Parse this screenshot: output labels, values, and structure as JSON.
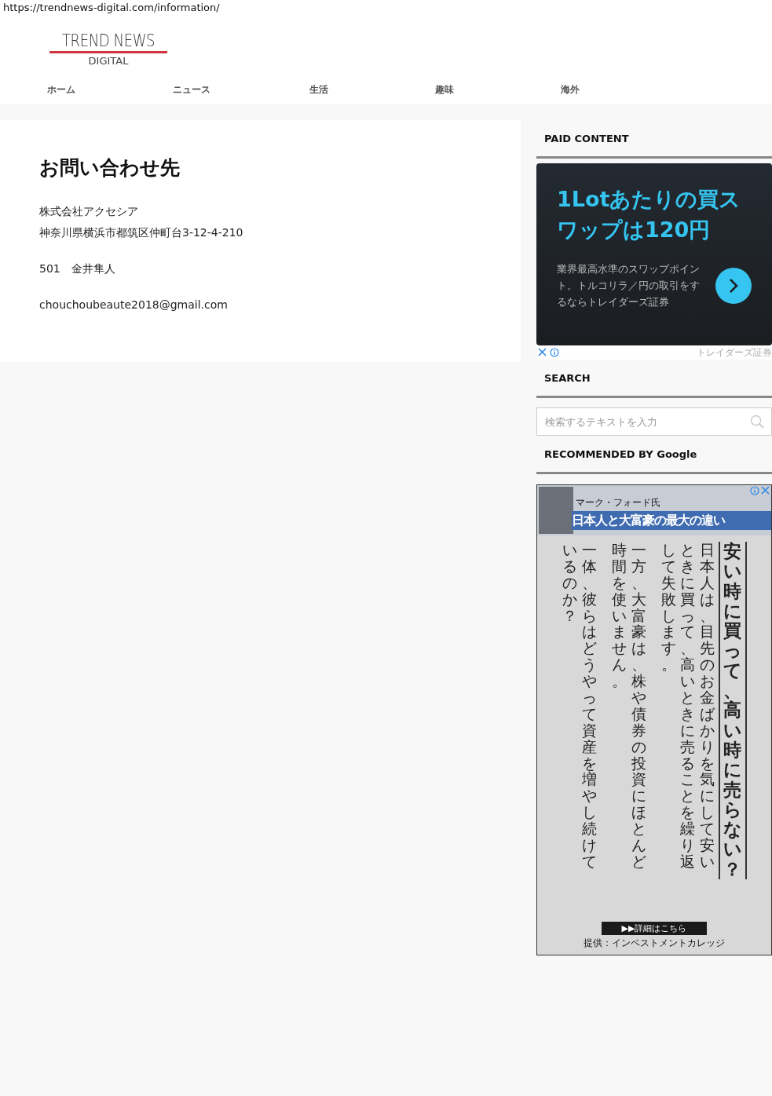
{
  "print_header": {
    "url": "https://trendnews-digital.com/information/"
  },
  "logo": {
    "title": "TREND NEWS",
    "subtitle": "DIGITAL"
  },
  "nav": [
    {
      "label": "ホーム"
    },
    {
      "label": "ニュース"
    },
    {
      "label": "生活"
    },
    {
      "label": "趣味"
    },
    {
      "label": "海外"
    }
  ],
  "article": {
    "title": "お問い合わせ先",
    "paragraphs": [
      [
        "株式会社アクセシア",
        "神奈川県横浜市都筑区仲町台3-12-4-210"
      ],
      [
        "501　金井隼人"
      ],
      [
        "chouchoubeaute2018@gmail.com"
      ]
    ]
  },
  "sidebar": {
    "paid": {
      "heading": "PAID CONTENT",
      "ad": {
        "headline": "1Lotあたりの買スワップは120円",
        "body": "業界最高水準のスワップポイント。トルコリラ／円の取引をするならトレイダーズ証券",
        "advertiser": "トレイダーズ証券"
      }
    },
    "search": {
      "heading": "SEARCH",
      "placeholder": "検索するテキストを入力"
    },
    "recommended": {
      "heading": "RECOMMENDED BY Google",
      "ad": {
        "name_caption": "マーク・フォード氏",
        "banner": "日本人と大富豪の最大の違い",
        "columns": [
          {
            "kind": "body",
            "text": "いるのか？"
          },
          {
            "kind": "body",
            "text": "一体、彼らはどうやって資産を増やし続けて"
          },
          {
            "kind": "spacer"
          },
          {
            "kind": "body",
            "text": "時間を使いません。"
          },
          {
            "kind": "body",
            "text": "一方、大富豪は、株や債券の投資にほとんど"
          },
          {
            "kind": "spacer"
          },
          {
            "kind": "body",
            "text": "して失敗します。"
          },
          {
            "kind": "body",
            "text": "ときに買って、高いときに売ることを繰り返"
          },
          {
            "kind": "body",
            "text": "日本人は、目先のお金ばかりを気にして安い"
          },
          {
            "kind": "headline",
            "text": "安い時に買って、高い時に売らない？"
          }
        ],
        "cta": "▶▶詳細はこちら",
        "credit": "提供：インベストメントカレッジ"
      }
    }
  }
}
